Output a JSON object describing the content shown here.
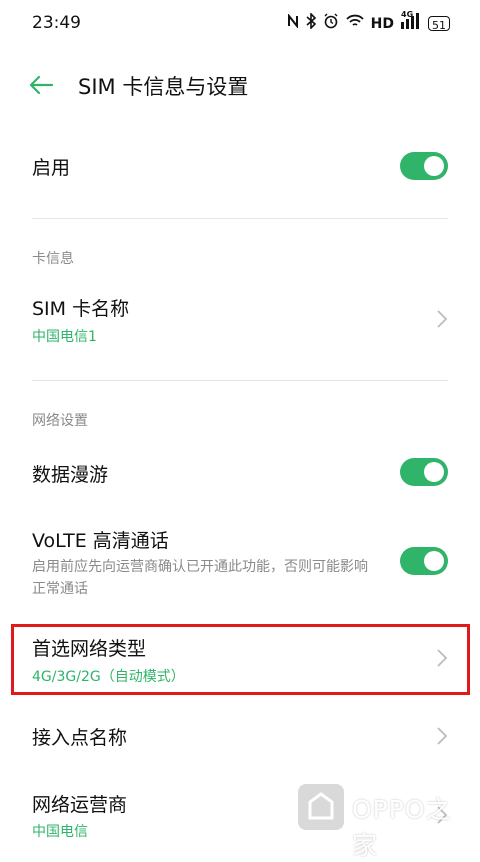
{
  "status_bar": {
    "time": "23:49",
    "icons": [
      "nfc-icon",
      "bluetooth-icon",
      "alarm-icon",
      "wifi-icon",
      "hd-icon",
      "signal-icon",
      "battery-icon"
    ],
    "hd": "HD",
    "network": "4G",
    "battery": "51"
  },
  "header": {
    "title": "SIM 卡信息与设置"
  },
  "enable": {
    "label": "启用",
    "on": true
  },
  "sections": {
    "card_info": "卡信息",
    "network": "网络设置"
  },
  "sim_name": {
    "label": "SIM 卡名称",
    "value": "中国电信1"
  },
  "roaming": {
    "label": "数据漫游",
    "on": true
  },
  "volte": {
    "label": "VoLTE 高清通话",
    "desc": "启用前应先向运营商确认已开通此功能，否则可能影响正常通话",
    "on": true
  },
  "preferred_network": {
    "label": "首选网络类型",
    "value": "4G/3G/2G（自动模式）"
  },
  "apn": {
    "label": "接入点名称"
  },
  "carrier": {
    "label": "网络运营商",
    "value": "中国电信"
  },
  "watermark": {
    "text": "OPPO之家"
  },
  "colors": {
    "accent": "#2fb46a",
    "highlight": "#e0191b"
  }
}
